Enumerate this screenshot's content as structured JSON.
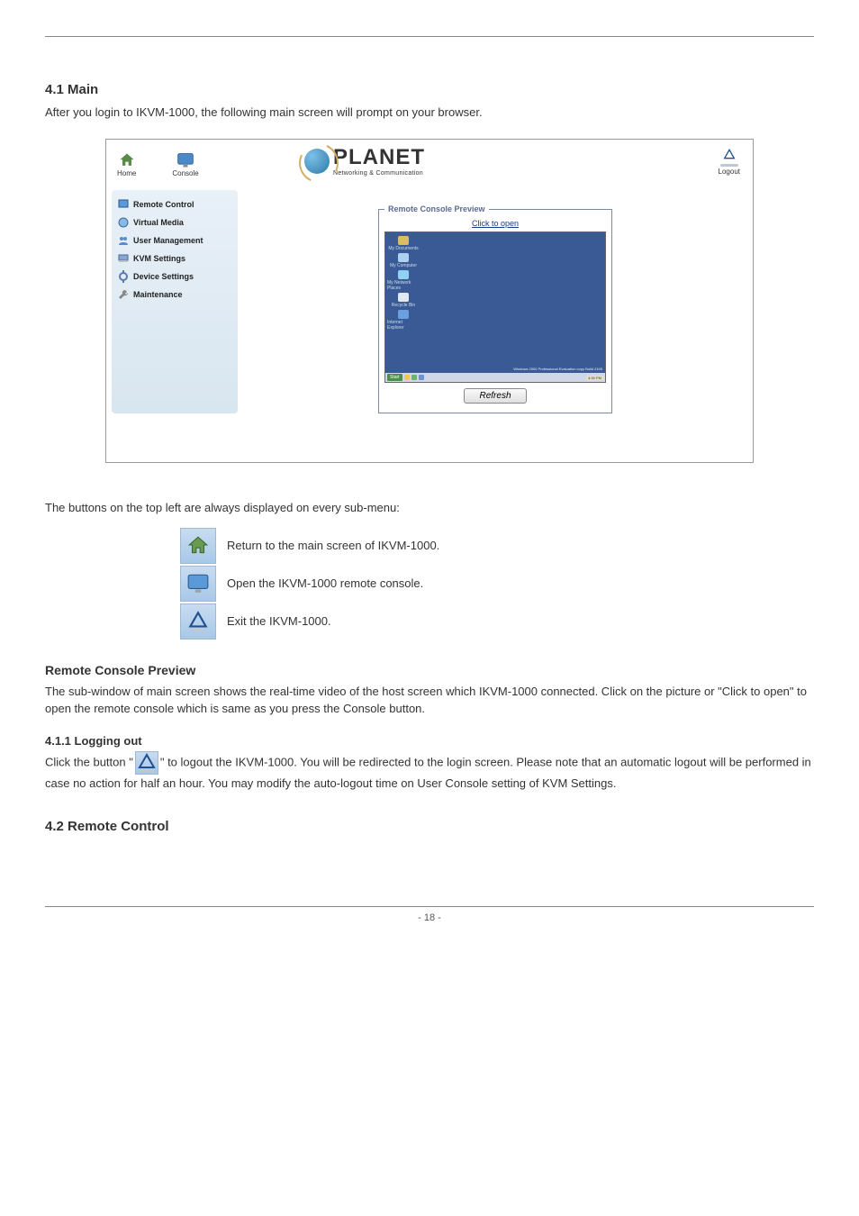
{
  "section41": {
    "heading": "4.1 Main",
    "paragraph": "After you login to IKVM-1000, the following main screen will prompt on your browser."
  },
  "screenshot": {
    "topIcons": {
      "home": "Home",
      "console": "Console",
      "logout": "Logout"
    },
    "brand": {
      "name": "PLANET",
      "tagline": "Networking & Communication"
    },
    "sidebar": {
      "items": [
        {
          "label": "Remote Control"
        },
        {
          "label": "Virtual Media"
        },
        {
          "label": "User Management"
        },
        {
          "label": "KVM Settings"
        },
        {
          "label": "Device Settings"
        },
        {
          "label": "Maintenance"
        }
      ]
    },
    "preview": {
      "legend": "Remote Console Preview",
      "clickOpen": "Click to open",
      "refresh": "Refresh",
      "deskIcons": [
        "My Documents",
        "My Computer",
        "My Network Places",
        "Recycle Bin",
        "Internet Explorer"
      ],
      "start": "Start",
      "winInfo": "Windows 2000 Professional\nEvaluation copy  Build 2195",
      "taskTime": "4:30 PM"
    }
  },
  "buttons": {
    "lead": "The buttons on the top left are always displayed on every sub-menu:",
    "rows": [
      {
        "icon": "home",
        "text": "Return to the main screen of IKVM-1000."
      },
      {
        "icon": "console",
        "text": "Open the IKVM-1000 remote console."
      },
      {
        "icon": "logout",
        "text": "Exit the IKVM-1000."
      }
    ]
  },
  "remoteConsolePreview": {
    "title": "Remote Console Preview",
    "text": "The sub-window of main screen shows the real-time video of the host screen which IKVM-1000 connected. Click on the picture or \"Click to open\" to open the remote console which is same as you press the Console button."
  },
  "logging": {
    "title": "4.1.1 Logging out",
    "para1_prefix": "Click the button \"",
    "para1_suffix": "\" to logout the IKVM-1000. You will be redirected to the login screen. Please note that an automatic logout will be performed in case no action for half an hour. You may modify the auto-logout time on User Console setting of KVM Settings."
  },
  "section42": {
    "title": "4.2 Remote Control"
  },
  "footer": "- 18 -"
}
